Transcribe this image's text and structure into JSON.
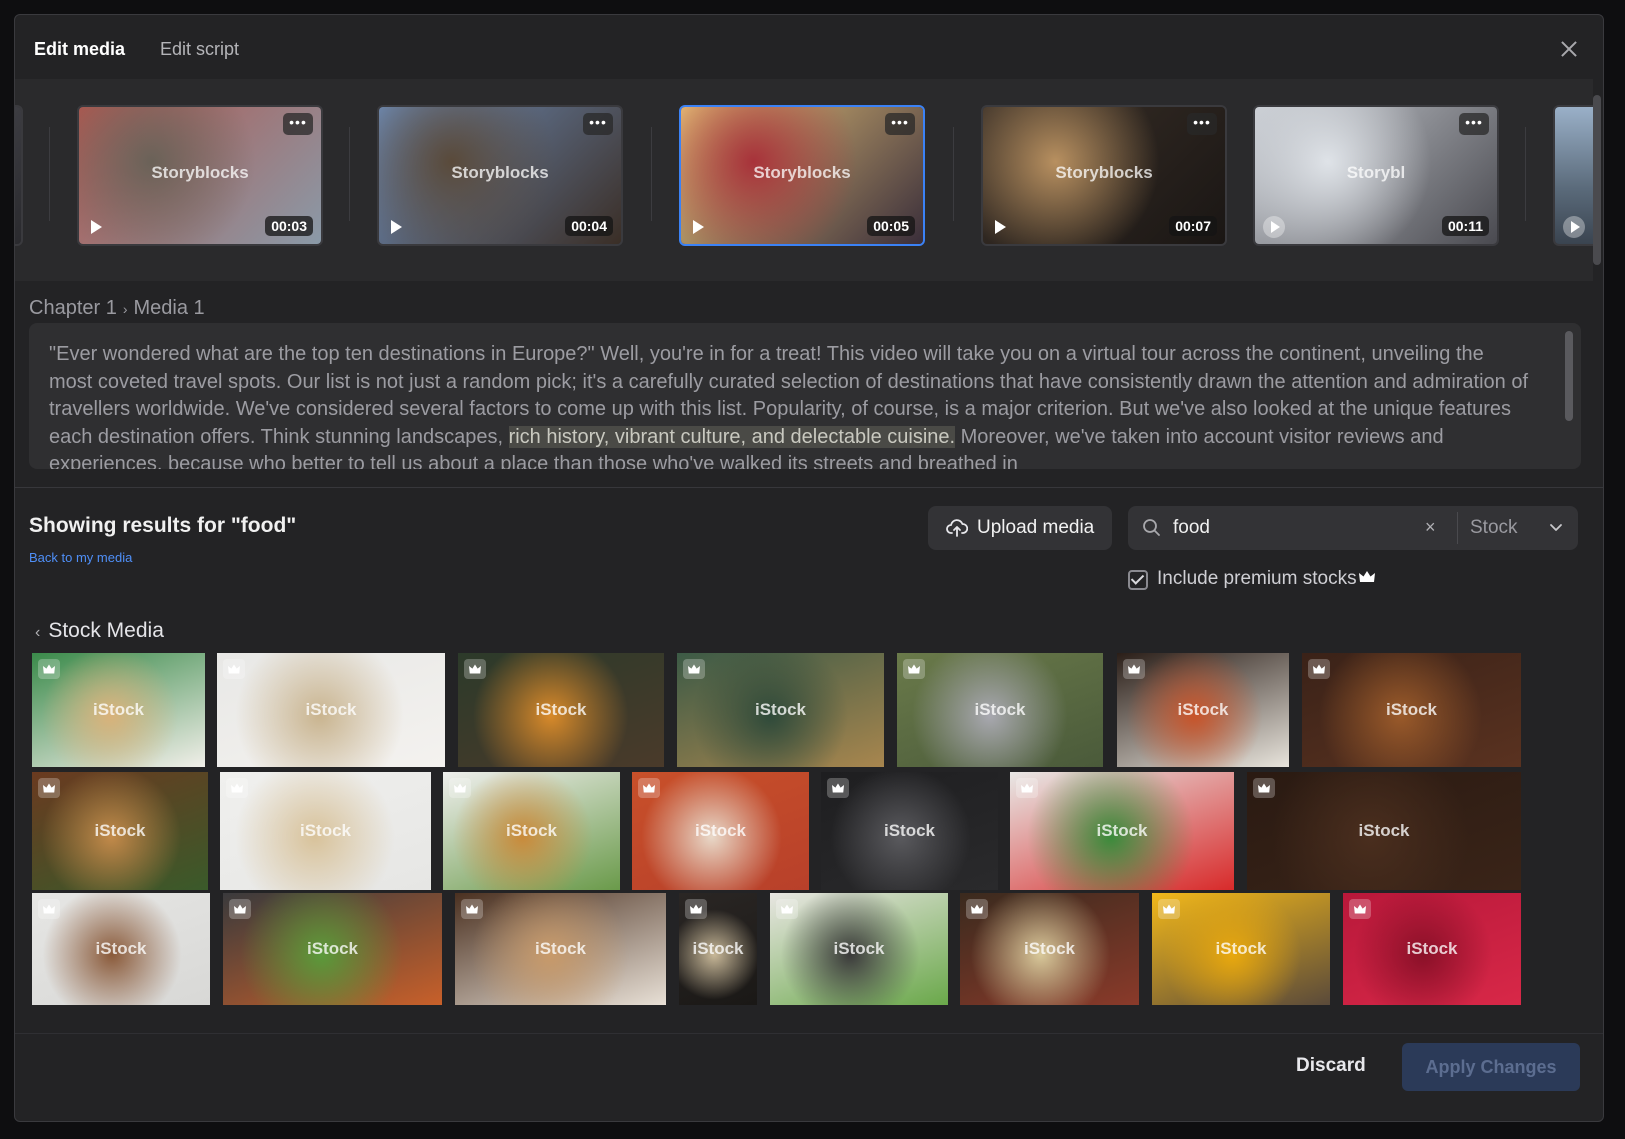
{
  "header": {
    "tab_active": "Edit media",
    "tab_inactive": "Edit script"
  },
  "scenes": [
    {
      "watermark": "Storyblocks",
      "duration": "00:03",
      "colors": [
        "#b0574f",
        "#6a6258",
        "#8a9aa8"
      ]
    },
    {
      "watermark": "Storyblocks",
      "duration": "00:04",
      "colors": [
        "#6f8db8",
        "#5a4a3a",
        "#3a2e26"
      ]
    },
    {
      "watermark": "Storyblocks",
      "duration": "00:05",
      "colors": [
        "#e9c57a",
        "#a8323a",
        "#3a2e3a"
      ]
    },
    {
      "watermark": "Storyblocks",
      "duration": "00:07",
      "colors": [
        "#3a3028",
        "#b89060",
        "#1a1614"
      ]
    },
    {
      "watermark": "Storybl",
      "duration": "00:11",
      "colors": [
        "#c8ccd2",
        "#dfe3e8",
        "#4a4a50"
      ]
    }
  ],
  "breadcrumb": {
    "chapter": "Chapter 1",
    "media": "Media 1"
  },
  "script": {
    "before": "\"Ever wondered what are the top ten destinations in Europe?\" Well, you're in for a treat! This video will take you on a virtual tour across the continent, unveiling the most coveted travel spots. Our list is not just a random pick; it's a carefully curated selection of destinations that have consistently drawn the attention and admiration of travellers worldwide. We've considered several factors to come up with this list. Popularity, of course, is a major criterion. But we've also looked at the unique features each destination offers. Think stunning landscapes, ",
    "highlight": "rich history, vibrant culture, and delectable cuisine.",
    "after": " Moreover, we've taken into account visitor reviews and experiences, because who better to tell us about a place than those who've walked its streets and breathed in"
  },
  "results": {
    "title": "Showing results for \"food\"",
    "back_link": "Back to my media"
  },
  "upload_button": "Upload media",
  "search": {
    "value": "food",
    "clear": "×",
    "filter": "Stock"
  },
  "premium": {
    "label": "Include premium stocks",
    "checked": true
  },
  "section": {
    "title": "Stock Media"
  },
  "stock_tiles": [
    {
      "watermark": "iStock",
      "colors": [
        "#3a8a4a",
        "#d9b27a",
        "#f1efe9"
      ]
    },
    {
      "watermark": "iStock",
      "colors": [
        "#e8e8e6",
        "#c9b48f",
        "#f4f2ef"
      ]
    },
    {
      "watermark": "iStock",
      "colors": [
        "#2c3a2a",
        "#d88a2a",
        "#4a3a2a"
      ]
    },
    {
      "watermark": "iStock",
      "colors": [
        "#3c5a46",
        "#2f4a3a",
        "#a8864e"
      ]
    },
    {
      "watermark": "iStock",
      "colors": [
        "#6a7a4a",
        "#a8a8b0",
        "#4a5a3a"
      ]
    },
    {
      "watermark": "iStock",
      "colors": [
        "#2a1e18",
        "#c8542a",
        "#e8e4dc"
      ]
    },
    {
      "watermark": "iStock",
      "colors": [
        "#3a2218",
        "#9a5a2a",
        "#5a3220"
      ]
    },
    {
      "watermark": "iStock",
      "colors": [
        "#6a3a20",
        "#c28a4a",
        "#3a5a2a"
      ]
    },
    {
      "watermark": "iStock",
      "colors": [
        "#f0f0ee",
        "#d8c29a",
        "#e6e6e4"
      ]
    },
    {
      "watermark": "iStock",
      "colors": [
        "#efefed",
        "#c98a3a",
        "#6a9a4a"
      ]
    },
    {
      "watermark": "iStock",
      "colors": [
        "#c8502a",
        "#e8d8c8",
        "#b8402a"
      ]
    },
    {
      "watermark": "iStock",
      "colors": [
        "#1e1e20",
        "#5a5a5e",
        "#2a2a2c"
      ]
    },
    {
      "watermark": "iStock",
      "colors": [
        "#e8e8e6",
        "#3a8a3a",
        "#d82a2a"
      ]
    },
    {
      "watermark": "iStock",
      "colors": [
        "#2a1a12",
        "#4a2e1e",
        "#3a2418"
      ]
    },
    {
      "watermark": "iStock",
      "colors": [
        "#e6e6e4",
        "#8a5a3a",
        "#d8d8d6"
      ]
    },
    {
      "watermark": "iStock",
      "colors": [
        "#3a3a3c",
        "#5a9a3a",
        "#c8602a"
      ]
    },
    {
      "watermark": "iStock",
      "colors": [
        "#4a3020",
        "#c89a6a",
        "#e8e0d6"
      ]
    },
    {
      "watermark": "iStock",
      "colors": [
        "#2a2624",
        "#c8b898",
        "#1a1816"
      ]
    },
    {
      "watermark": "iStock",
      "colors": [
        "#e8e6e2",
        "#3a3a3a",
        "#6aa84a"
      ]
    },
    {
      "watermark": "iStock",
      "colors": [
        "#3a2a1e",
        "#d8c89a",
        "#8a3a2a"
      ]
    },
    {
      "watermark": "iStock",
      "colors": [
        "#f2b81a",
        "#e8a80e",
        "#5a4a3a"
      ]
    },
    {
      "watermark": "iStock",
      "colors": [
        "#b8183a",
        "#8a1028",
        "#d82848"
      ]
    }
  ],
  "footer": {
    "discard": "Discard",
    "apply": "Apply Changes"
  },
  "accent": "#3b82f6"
}
